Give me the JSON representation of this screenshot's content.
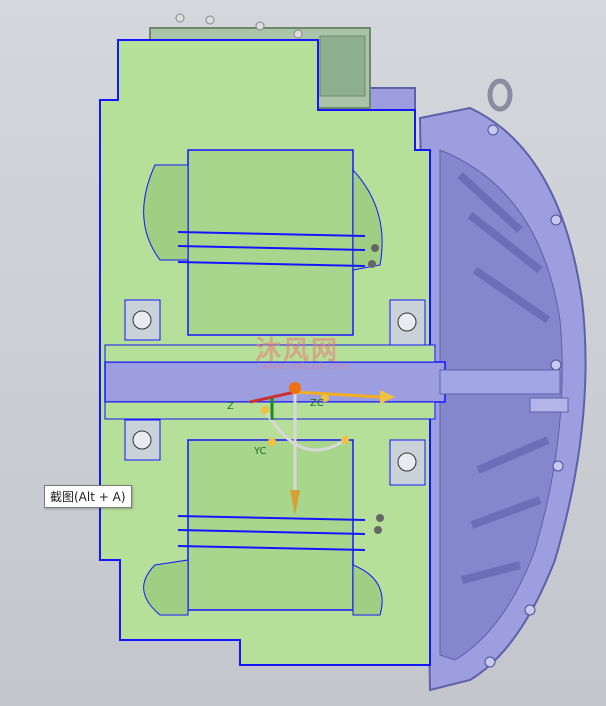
{
  "viewport": {
    "axis_labels": {
      "z": "Z",
      "zc": "ZC",
      "yc": "YC"
    },
    "watermark": {
      "text": "沐风网",
      "subtext": "www.mfcad.com"
    },
    "colors": {
      "background": "#c9ccd2",
      "section_face": "#b6e09a",
      "edge_lines": "#1515ff",
      "housing_body": "#9c9ee0",
      "housing_dark": "#6c6fb8",
      "terminal_box": "#a9c4a9"
    }
  },
  "tooltip": {
    "text": "截图(Alt + A)"
  }
}
